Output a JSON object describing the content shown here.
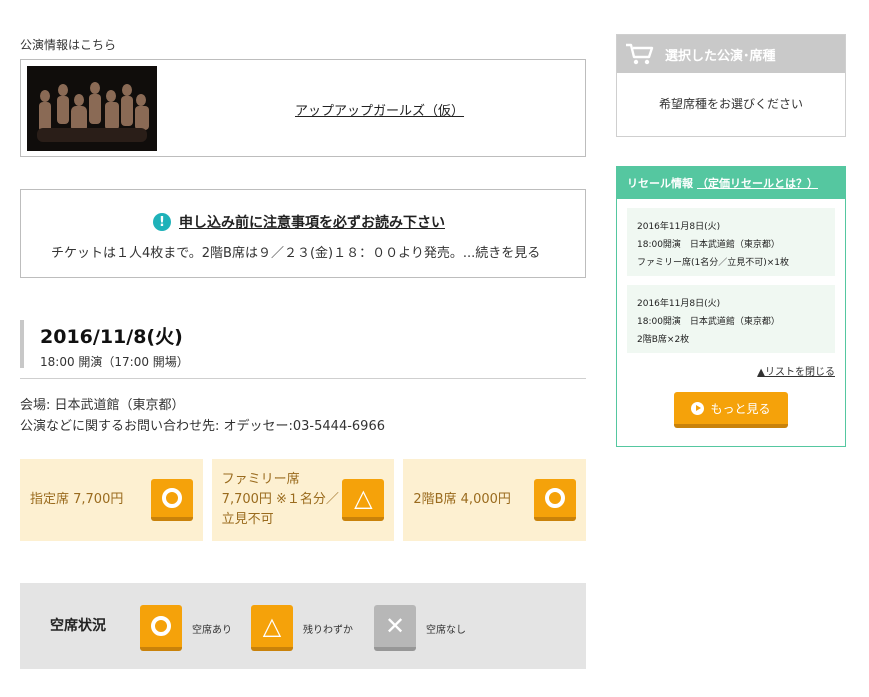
{
  "performance_info": {
    "heading": "公演情報はこちら",
    "performer_name": "アップアップガールズ（仮）"
  },
  "notice": {
    "title": "申し込み前に注意事項を必ずお読み下さい",
    "text": "チケットは１人4枚まで。2階B席は９／２３(金)１８：００より発売。...続きを見る"
  },
  "event": {
    "date": "2016/11/8(火)",
    "time": "18:00 開演（17:00 開場）",
    "venue": "会場: 日本武道館（東京都）",
    "contact": "公演などに関するお問い合わせ先: オデッセー:03-5444-6966"
  },
  "seats": [
    {
      "name": "指定席 7,700円",
      "status": "available",
      "icon": "circle-icon"
    },
    {
      "name": "ファミリー席 7,700円 ※１名分／立見不可",
      "status": "few-left",
      "icon": "triangle-icon",
      "glyph": "△"
    },
    {
      "name": "2階B席 4,000円",
      "status": "available",
      "icon": "circle-icon"
    }
  ],
  "legend": {
    "title": "空席状況",
    "available": "空席あり",
    "few_left": "残りわずか",
    "sold_out": "空席なし",
    "triangle_glyph": "△",
    "cross_glyph": "✕"
  },
  "cart": {
    "title": "選択した公演･席種",
    "placeholder": "希望席種をお選びください"
  },
  "resale": {
    "title": "リセール情報",
    "link": "（定価リセールとは？）",
    "items": [
      {
        "date": "2016年11月8日(火)",
        "venue": "18:00開演　日本武道館（東京都）",
        "seat": "ファミリー席(1名分／立見不可)×1枚"
      },
      {
        "date": "2016年11月8日(火)",
        "venue": "18:00開演　日本武道館（東京都）",
        "seat": "2階B席×2枚"
      }
    ],
    "close_list": "▲リストを閉じる",
    "more_button": "もっと見る"
  },
  "colors": {
    "accent_orange": "#f5a20a",
    "seat_card_bg": "#fdf0d1",
    "resale_green": "#55c7a0",
    "notice_teal": "#1fb2b9",
    "sold_out_gray": "#b7b7b7"
  }
}
